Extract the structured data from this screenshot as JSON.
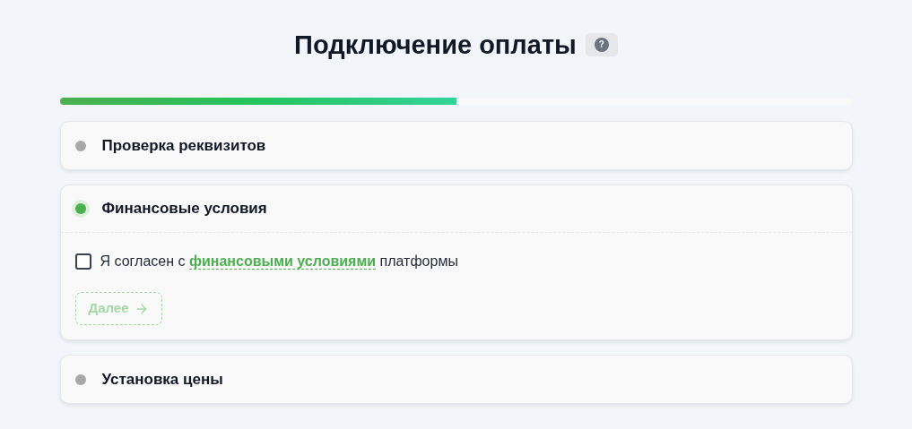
{
  "title": "Подключение оплаты",
  "help": {
    "label": "?"
  },
  "progress": {
    "level": 0.5
  },
  "steps": [
    {
      "title": "Проверка реквизитов",
      "active": false,
      "expanded": false
    },
    {
      "title": "Финансовые условия",
      "active": true,
      "expanded": true,
      "agreement": {
        "checked": false,
        "prefix": "Я согласен с",
        "link": "финансовыми условиями",
        "suffix": "платформы"
      },
      "next_button": {
        "label": "Далее",
        "disabled": true
      }
    },
    {
      "title": "Установка цены",
      "active": false,
      "expanded": false
    }
  ]
}
